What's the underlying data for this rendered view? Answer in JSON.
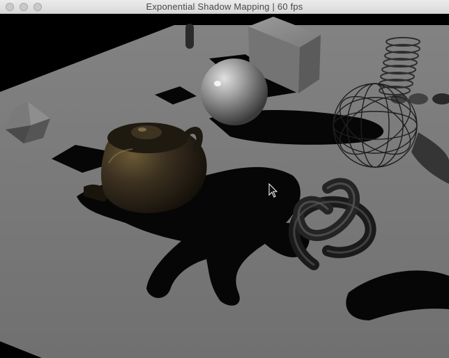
{
  "window": {
    "title": "Exponential Shadow Mapping | 60 fps",
    "buttons": [
      "close",
      "minimize",
      "zoom"
    ]
  },
  "scene": {
    "objects": [
      "cube",
      "sphere",
      "teapot",
      "torus-knot",
      "spring",
      "wire-sphere",
      "octahedron",
      "capsule"
    ],
    "icons": [
      "mouse-cursor-icon"
    ]
  },
  "colors": {
    "floor": "#7f7f7f",
    "background": "#000000",
    "shadow": "#0a0a0a",
    "teapot": "#2b2415"
  }
}
